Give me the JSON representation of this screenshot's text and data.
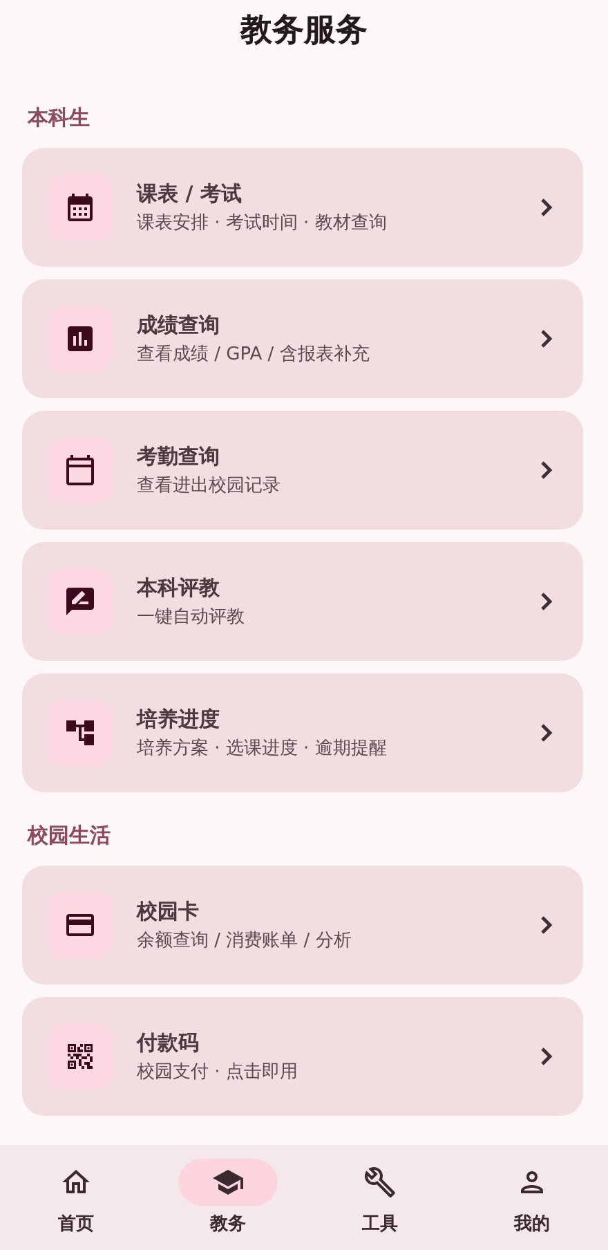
{
  "title": "教务服务",
  "sections": [
    {
      "heading": "本科生",
      "items": [
        {
          "title": "课表 / 考试",
          "subtitle": "课表安排 · 考试时间 · 教材查询"
        },
        {
          "title": "成绩查询",
          "subtitle": "查看成绩 / GPA / 含报表补充"
        },
        {
          "title": "考勤查询",
          "subtitle": "查看进出校园记录"
        },
        {
          "title": "本科评教",
          "subtitle": "一键自动评教"
        },
        {
          "title": "培养进度",
          "subtitle": "培养方案 · 选课进度 · 逾期提醒"
        }
      ]
    },
    {
      "heading": "校园生活",
      "items": [
        {
          "title": "校园卡",
          "subtitle": "余额查询 / 消费账单 / 分析"
        },
        {
          "title": "付款码",
          "subtitle": "校园支付 · 点击即用"
        }
      ]
    }
  ],
  "nav": [
    {
      "label": "首页",
      "selected": false
    },
    {
      "label": "教务",
      "selected": true
    },
    {
      "label": "工具",
      "selected": false
    },
    {
      "label": "我的",
      "selected": false
    }
  ]
}
